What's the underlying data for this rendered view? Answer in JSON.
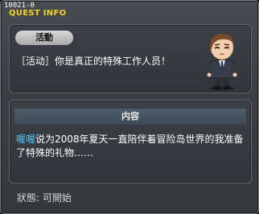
{
  "window": {
    "id": "10021-0",
    "title": "QUEST INFO"
  },
  "quest": {
    "category_badge": "活動",
    "name": "［活动］你是真正的特殊工作人员！"
  },
  "content": {
    "header": "内容",
    "npc_name": "喔喔",
    "body": "说为2008年夏天一直陪伴着冒险岛世界的我准备了特殊的礼物……"
  },
  "status": "狀態: 可開始",
  "colors": {
    "title": "#f4d327",
    "npc_name": "#48c3ff"
  },
  "icons": {
    "npc": "npc-businessman-portrait"
  }
}
